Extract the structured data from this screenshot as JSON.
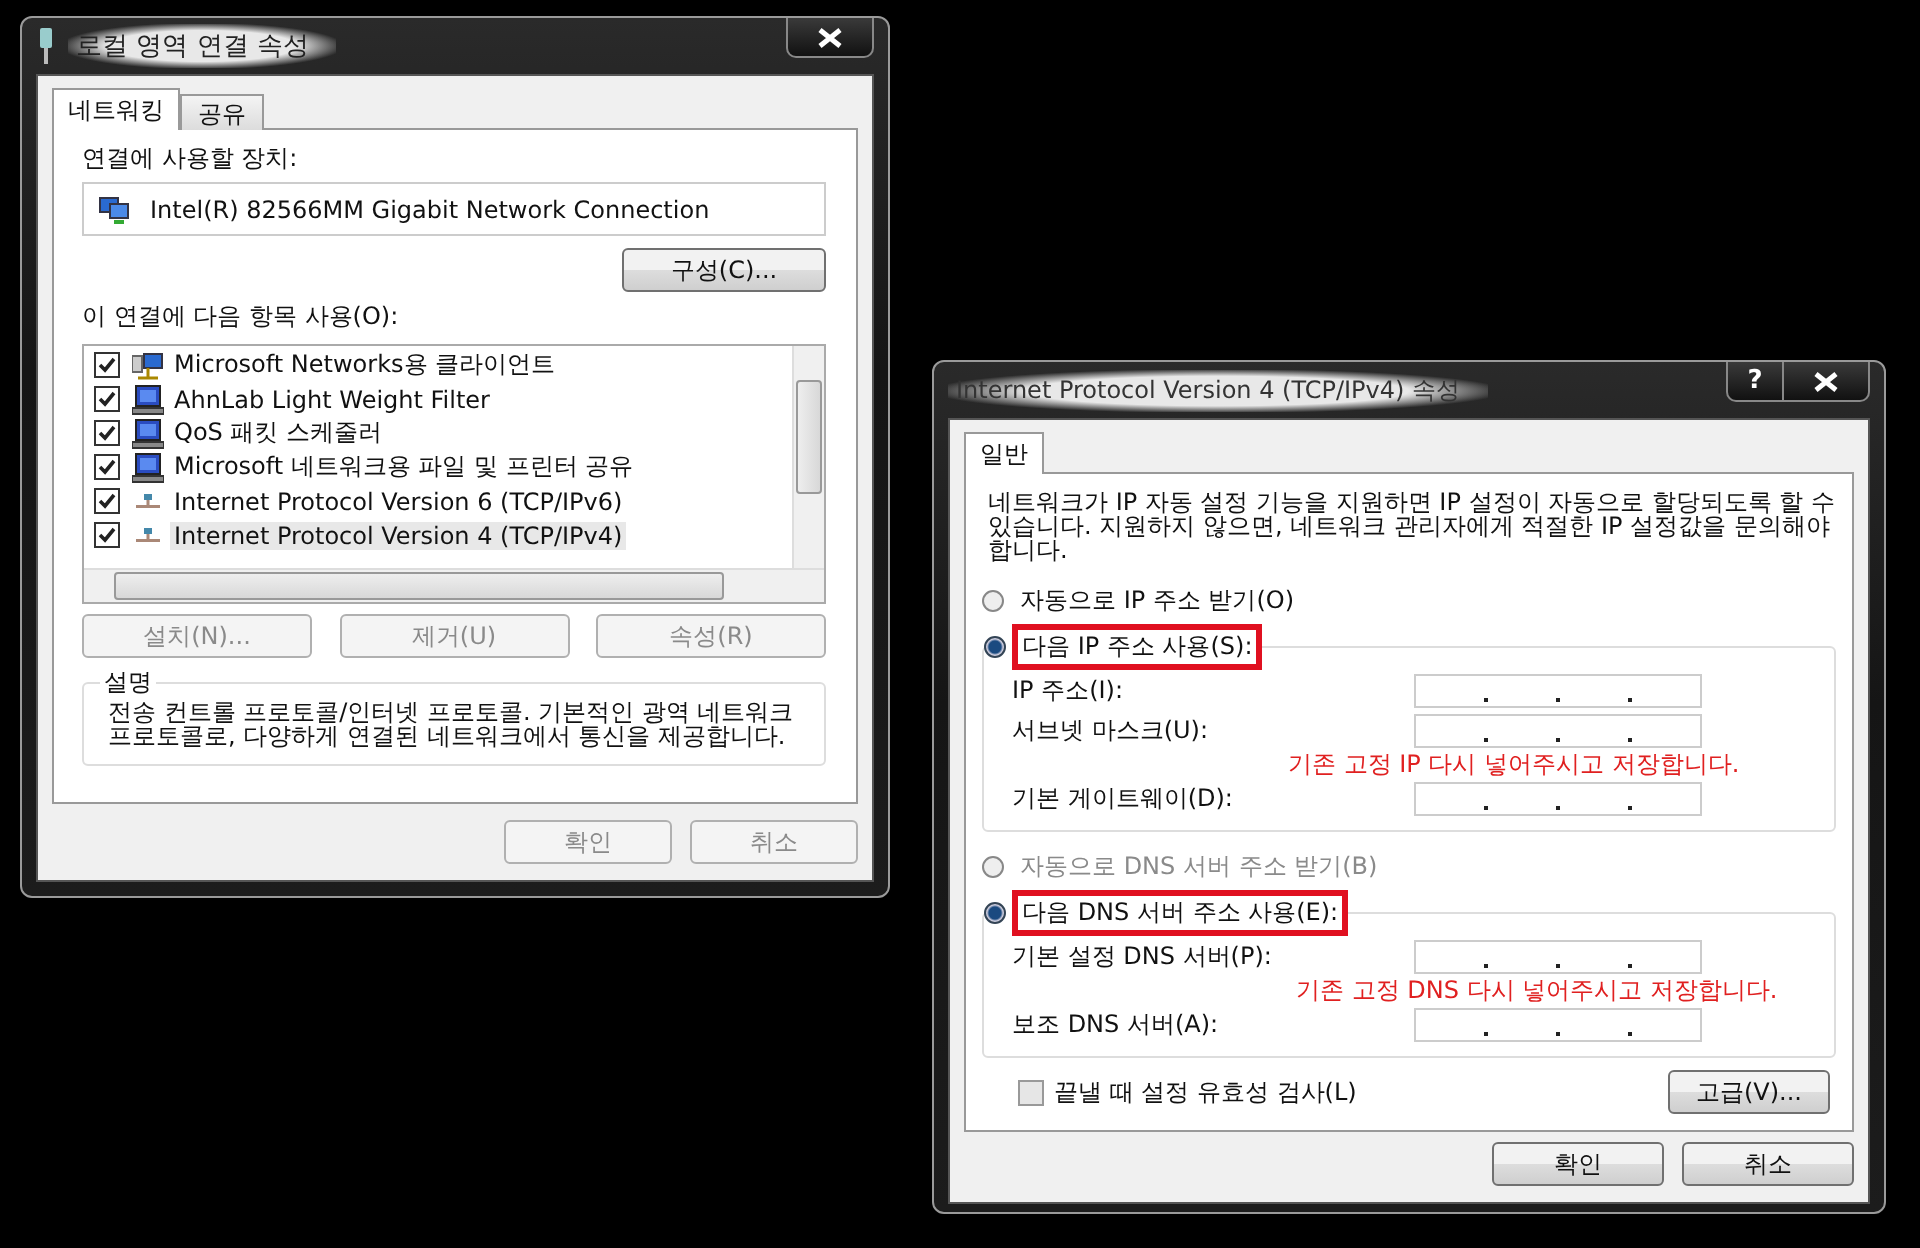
{
  "lan_properties": {
    "title": "로컬 영역 연결 속성",
    "tabs": [
      {
        "label": "네트워킹",
        "selected": true
      },
      {
        "label": "공유",
        "selected": false
      }
    ],
    "device_label": "연결에 사용할 장치:",
    "adapter": "Intel(R) 82566MM Gigabit Network Connection",
    "configure_button": "구성(C)...",
    "items_label": "이 연결에 다음 항목 사용(O):",
    "components": [
      {
        "label": "Microsoft Networks용 클라이언트",
        "checked": true,
        "selected": false,
        "kind": "client"
      },
      {
        "label": "AhnLab Light Weight Filter",
        "checked": true,
        "selected": false,
        "kind": "service"
      },
      {
        "label": "QoS 패킷 스케줄러",
        "checked": true,
        "selected": false,
        "kind": "service"
      },
      {
        "label": "Microsoft 네트워크용 파일 및 프린터 공유",
        "checked": true,
        "selected": false,
        "kind": "service"
      },
      {
        "label": "Internet Protocol Version 6 (TCP/IPv6)",
        "checked": true,
        "selected": false,
        "kind": "protocol"
      },
      {
        "label": "Internet Protocol Version 4 (TCP/IPv4)",
        "checked": true,
        "selected": true,
        "kind": "protocol"
      }
    ],
    "item_buttons": [
      {
        "label": "설치(N)...",
        "disabled": true
      },
      {
        "label": "제거(U)",
        "disabled": true
      },
      {
        "label": "속성(R)",
        "disabled": true
      }
    ],
    "description": {
      "legend": "설명",
      "text": "전송 컨트롤 프로토콜/인터넷 프로토콜. 기본적인 광역 네트워크 프로토콜로, 다양하게 연결된 네트워크에서 통신을 제공합니다."
    },
    "dialog_buttons": [
      {
        "label": "확인",
        "disabled": true
      },
      {
        "label": "취소",
        "disabled": true
      }
    ]
  },
  "ipv4_properties": {
    "title": "Internet Protocol Version 4 (TCP/IPv4) 속성",
    "help_button": "?",
    "tabs": [
      {
        "label": "일반",
        "selected": true
      }
    ],
    "intro": "네트워크가 IP 자동 설정 기능을 지원하면 IP 설정이 자동으로 할당되도록 할 수 있습니다. 지원하지 않으면, 네트워크 관리자에게 적절한 IP 설정값을 문의해야 합니다.",
    "ip_auto": {
      "label": "자동으로 IP 주소 받기(O)",
      "selected": false,
      "disabled": false,
      "highlighted": false
    },
    "ip_manual": {
      "label": "다음 IP 주소 사용(S):",
      "selected": true,
      "disabled": false,
      "highlighted": true
    },
    "ip_fields": [
      {
        "label": "IP 주소(I):"
      },
      {
        "label": "서브넷 마스크(U):"
      },
      {
        "label": "기본 게이트웨이(D):"
      }
    ],
    "ip_note": "기존 고정 IP 다시 넣어주시고 저장합니다.",
    "dns_auto": {
      "label": "자동으로 DNS 서버 주소 받기(B)",
      "selected": false,
      "disabled": true,
      "highlighted": false
    },
    "dns_manual": {
      "label": "다음 DNS 서버 주소 사용(E):",
      "selected": true,
      "disabled": false,
      "highlighted": true
    },
    "dns_fields": [
      {
        "label": "기본 설정 DNS 서버(P):"
      },
      {
        "label": "보조 DNS 서버(A):"
      }
    ],
    "dns_note": "기존 고정 DNS 다시 넣어주시고 저장합니다.",
    "validate": {
      "label": "끝낼 때 설정 유효성 검사(L)",
      "checked": false
    },
    "advanced_button": "고급(V)...",
    "dialog_buttons": [
      {
        "label": "확인",
        "disabled": false
      },
      {
        "label": "취소",
        "disabled": false
      }
    ]
  }
}
